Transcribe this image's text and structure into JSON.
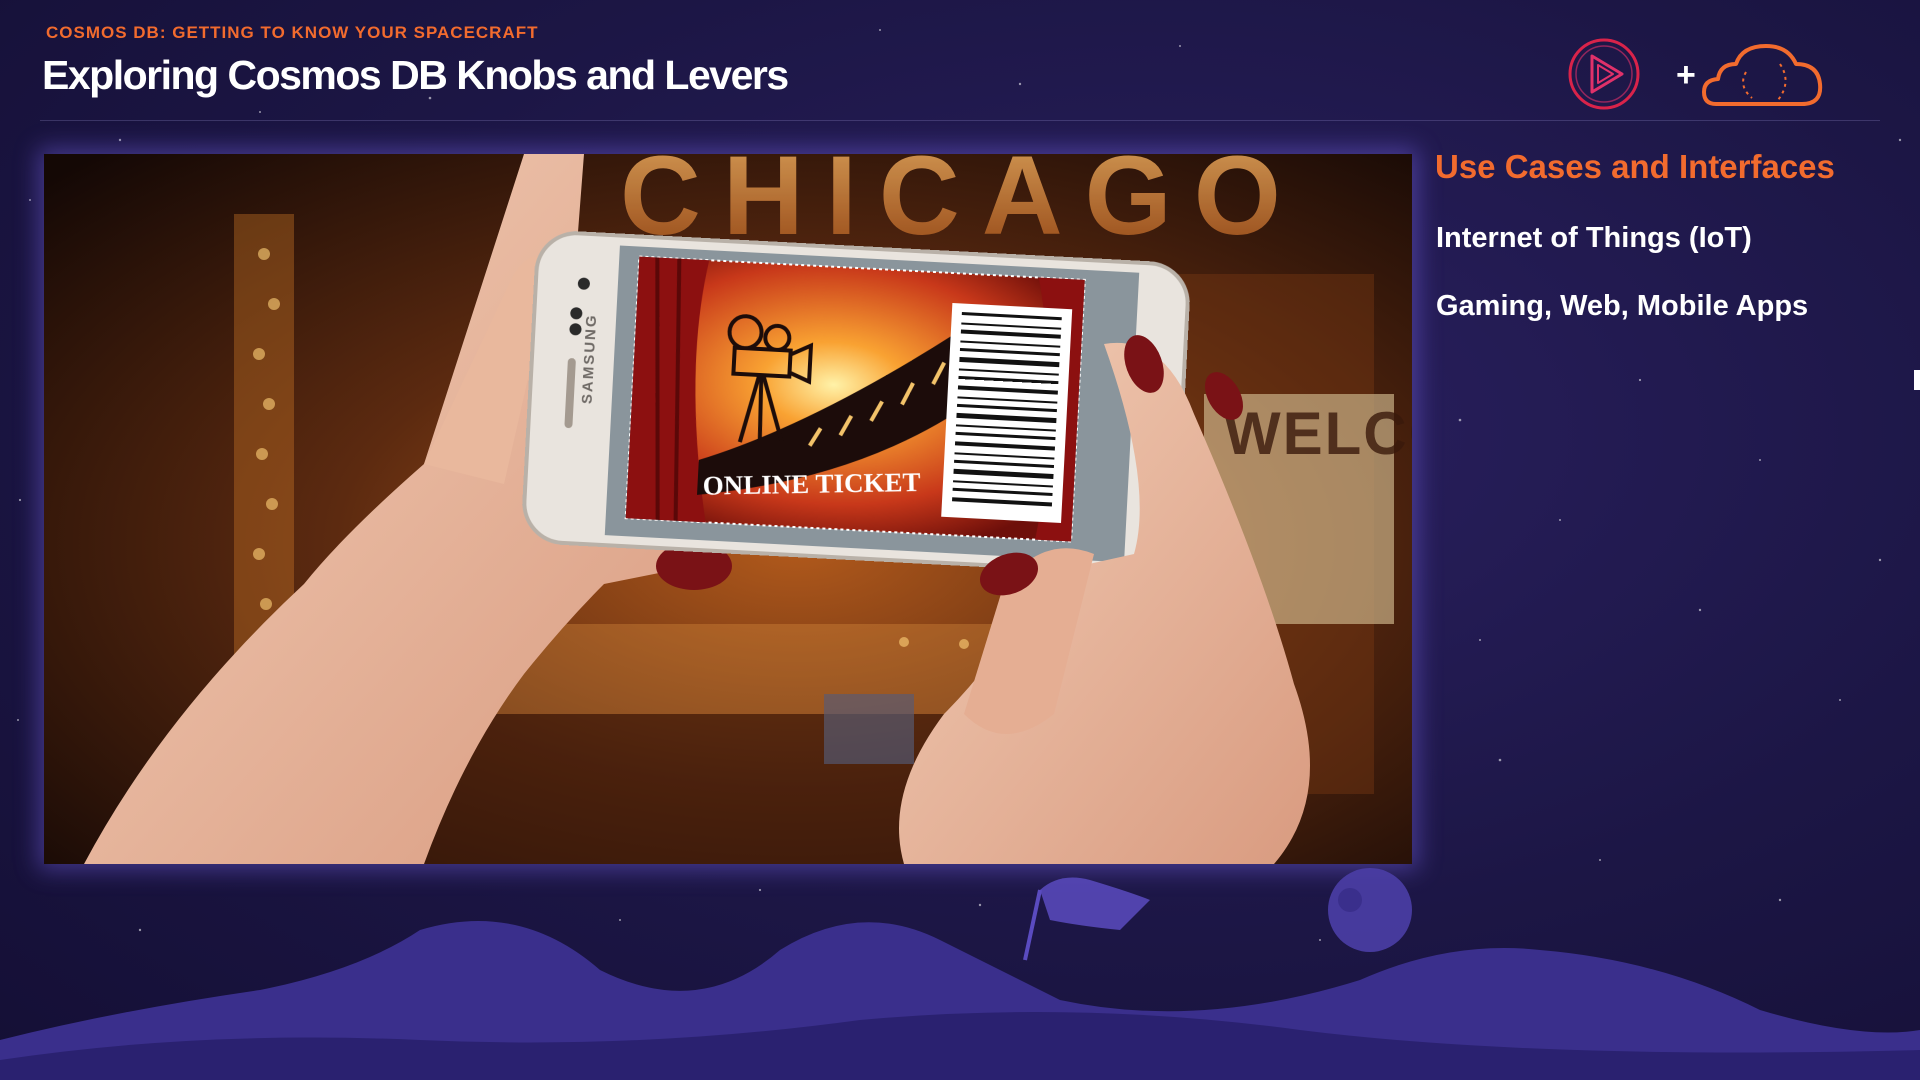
{
  "header": {
    "course_label": "COSMOS DB: GETTING TO KNOW YOUR SPACECRAFT",
    "module_title": "Exploring Cosmos DB Knobs and Levers"
  },
  "logos": {
    "plus_sign": "+",
    "left_logo": "play-logo-icon",
    "right_logo": "cloud-logo-icon"
  },
  "photo": {
    "marquee_text": "CHICAGO",
    "welcome_text": "WELCOM",
    "phone_brand": "SAMSUNG",
    "ticket_text": "ONLINE TICKET"
  },
  "sidebar": {
    "section_title": "Use Cases and Interfaces",
    "items": [
      "Internet of Things (IoT)",
      "Gaming, Web, Mobile Apps"
    ]
  },
  "colors": {
    "accent": "#f26b2e",
    "background": "#1c1645",
    "text": "#ffffff",
    "glow": "#7864e6"
  }
}
